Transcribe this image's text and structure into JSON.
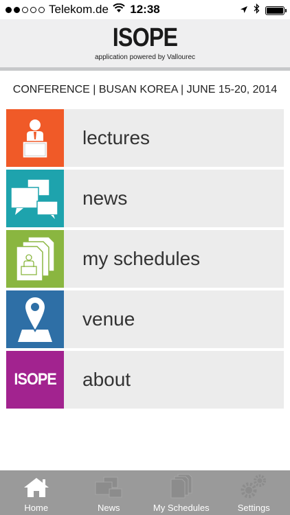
{
  "status": {
    "carrier": "Telekom.de",
    "time": "12:38",
    "signal_bars": 2,
    "signal_total": 5
  },
  "header": {
    "title": "ISOPE",
    "subtitle": "application powered by Vallourec"
  },
  "conference_line": "CONFERENCE | BUSAN KOREA | JUNE 15-20, 2014",
  "menu": {
    "items": [
      {
        "label": "lectures",
        "color": "#f05a28",
        "icon": "lecturer-icon"
      },
      {
        "label": "news",
        "color": "#1ea3ad",
        "icon": "speech-bubbles-icon"
      },
      {
        "label": "my schedules",
        "color": "#8ab640",
        "icon": "schedule-documents-icon"
      },
      {
        "label": "venue",
        "color": "#2e6fa6",
        "icon": "map-pin-icon"
      },
      {
        "label": "about",
        "color": "#a2238f",
        "icon": "isope-logo-icon",
        "icon_text": "ISOPE"
      }
    ]
  },
  "tabbar": {
    "items": [
      {
        "label": "Home",
        "icon": "home-icon",
        "active": true
      },
      {
        "label": "News",
        "icon": "news-icon",
        "active": false
      },
      {
        "label": "My Schedules",
        "icon": "schedules-icon",
        "active": false
      },
      {
        "label": "Settings",
        "icon": "settings-icon",
        "active": false
      }
    ]
  }
}
